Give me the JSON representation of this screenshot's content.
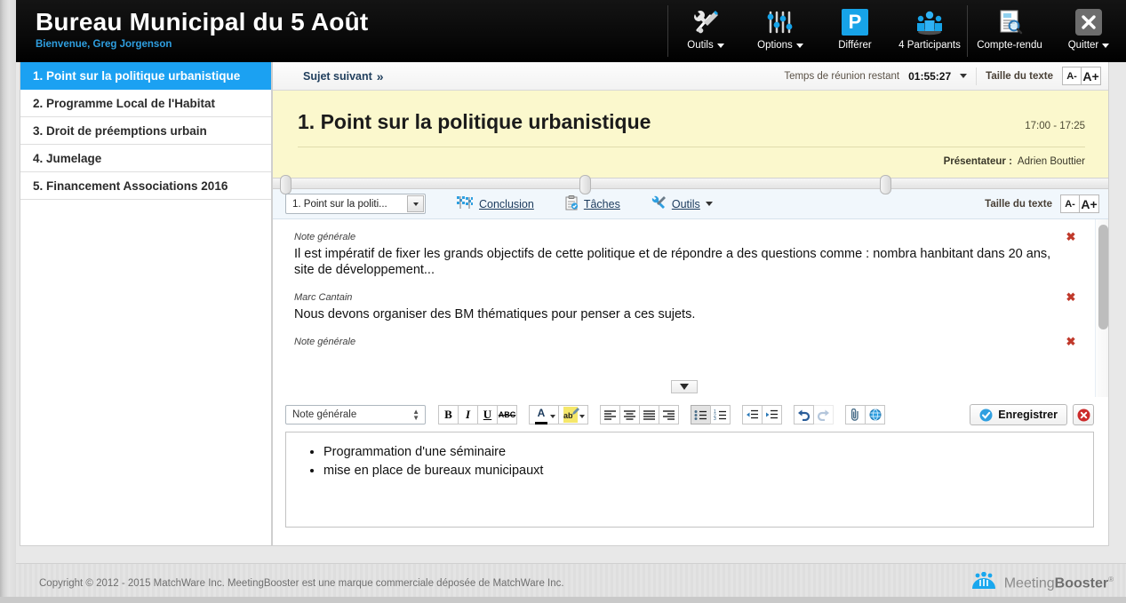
{
  "header": {
    "title": "Bureau Municipal du 5 Août",
    "welcome": "Bienvenue, Greg Jorgenson",
    "buttons": [
      {
        "label": "Outils",
        "icon": "wrench-screwdriver-icon",
        "has_caret": true
      },
      {
        "label": "Options",
        "icon": "sliders-icon",
        "has_caret": true
      },
      {
        "label": "Différer",
        "icon": "parking-p-icon",
        "has_caret": false
      },
      {
        "label": "4 Participants",
        "icon": "people-icon",
        "has_caret": false
      },
      {
        "label": "Compte-rendu",
        "icon": "document-search-icon",
        "has_caret": false
      },
      {
        "label": "Quitter",
        "icon": "close-x-icon",
        "has_caret": true
      }
    ]
  },
  "sidebar": {
    "items": [
      {
        "label": "1. Point sur la politique urbanistique",
        "active": true
      },
      {
        "label": "2. Programme Local de l'Habitat",
        "active": false
      },
      {
        "label": "3. Droit de préemptions urbain",
        "active": false
      },
      {
        "label": "4. Jumelage",
        "active": false
      },
      {
        "label": "5. Financement Associations 2016",
        "active": false
      }
    ]
  },
  "topbar": {
    "next_topic": "Sujet suivant",
    "next_topic_chevron": "»",
    "time_label": "Temps de réunion restant",
    "time_value": "01:55:27",
    "text_size_label": "Taille du texte",
    "text_size_smaller": "A-",
    "text_size_larger": "A+"
  },
  "topic": {
    "title": "1. Point sur la politique urbanistique",
    "time_range": "17:00 - 17:25",
    "presenter_label": "Présentateur :",
    "presenter_name": "Adrien Bouttier"
  },
  "notes_toolbar": {
    "topic_select": "1. Point sur la politi...",
    "conclusion": "Conclusion",
    "tasks": "Tâches",
    "tools": "Outils",
    "text_size_label": "Taille du texte",
    "text_size_smaller": "A-",
    "text_size_larger": "A+"
  },
  "notes": [
    {
      "author": "Note générale",
      "body": "Il est impératif de fixer les grands objectifs de cette politique et de répondre a des questions comme : nombra hanbitant dans 20 ans, site de développement..."
    },
    {
      "author": "Marc Cantain",
      "body": "Nous devons organiser des BM thématiques pour penser a ces sujets."
    },
    {
      "author": "Note générale",
      "body": ""
    }
  ],
  "editor": {
    "type_select": "Note générale",
    "buttons": {
      "bold": "B",
      "italic": "I",
      "underline": "U",
      "strikethrough": "ABC",
      "font_color": "A",
      "highlight": "ab",
      "align_left": "align-left-icon",
      "align_center": "align-center-icon",
      "align_justify": "align-justify-icon",
      "align_right": "align-right-icon",
      "bullet_list": "bullet-list-icon",
      "numbered_list": "numbered-list-icon",
      "outdent": "outdent-icon",
      "indent": "indent-icon",
      "undo": "undo-icon",
      "redo": "redo-icon",
      "attach": "paperclip-icon",
      "link": "globe-icon"
    },
    "save_label": "Enregistrer",
    "content_items": [
      "Programmation d'une séminaire",
      "mise en place de bureaux municipauxt"
    ]
  },
  "footer": {
    "copyright": "Copyright © 2012 - 2015 MatchWare Inc. MeetingBooster est une marque commerciale déposée de MatchWare Inc.",
    "logo_text_1": "Meeting",
    "logo_text_2": "Booster",
    "logo_reg": "®"
  },
  "colors": {
    "accent_blue": "#1ba1f2",
    "header_black": "#0b0b0b",
    "topic_yellow": "#fbf8cd",
    "delete_red": "#c0392b"
  }
}
